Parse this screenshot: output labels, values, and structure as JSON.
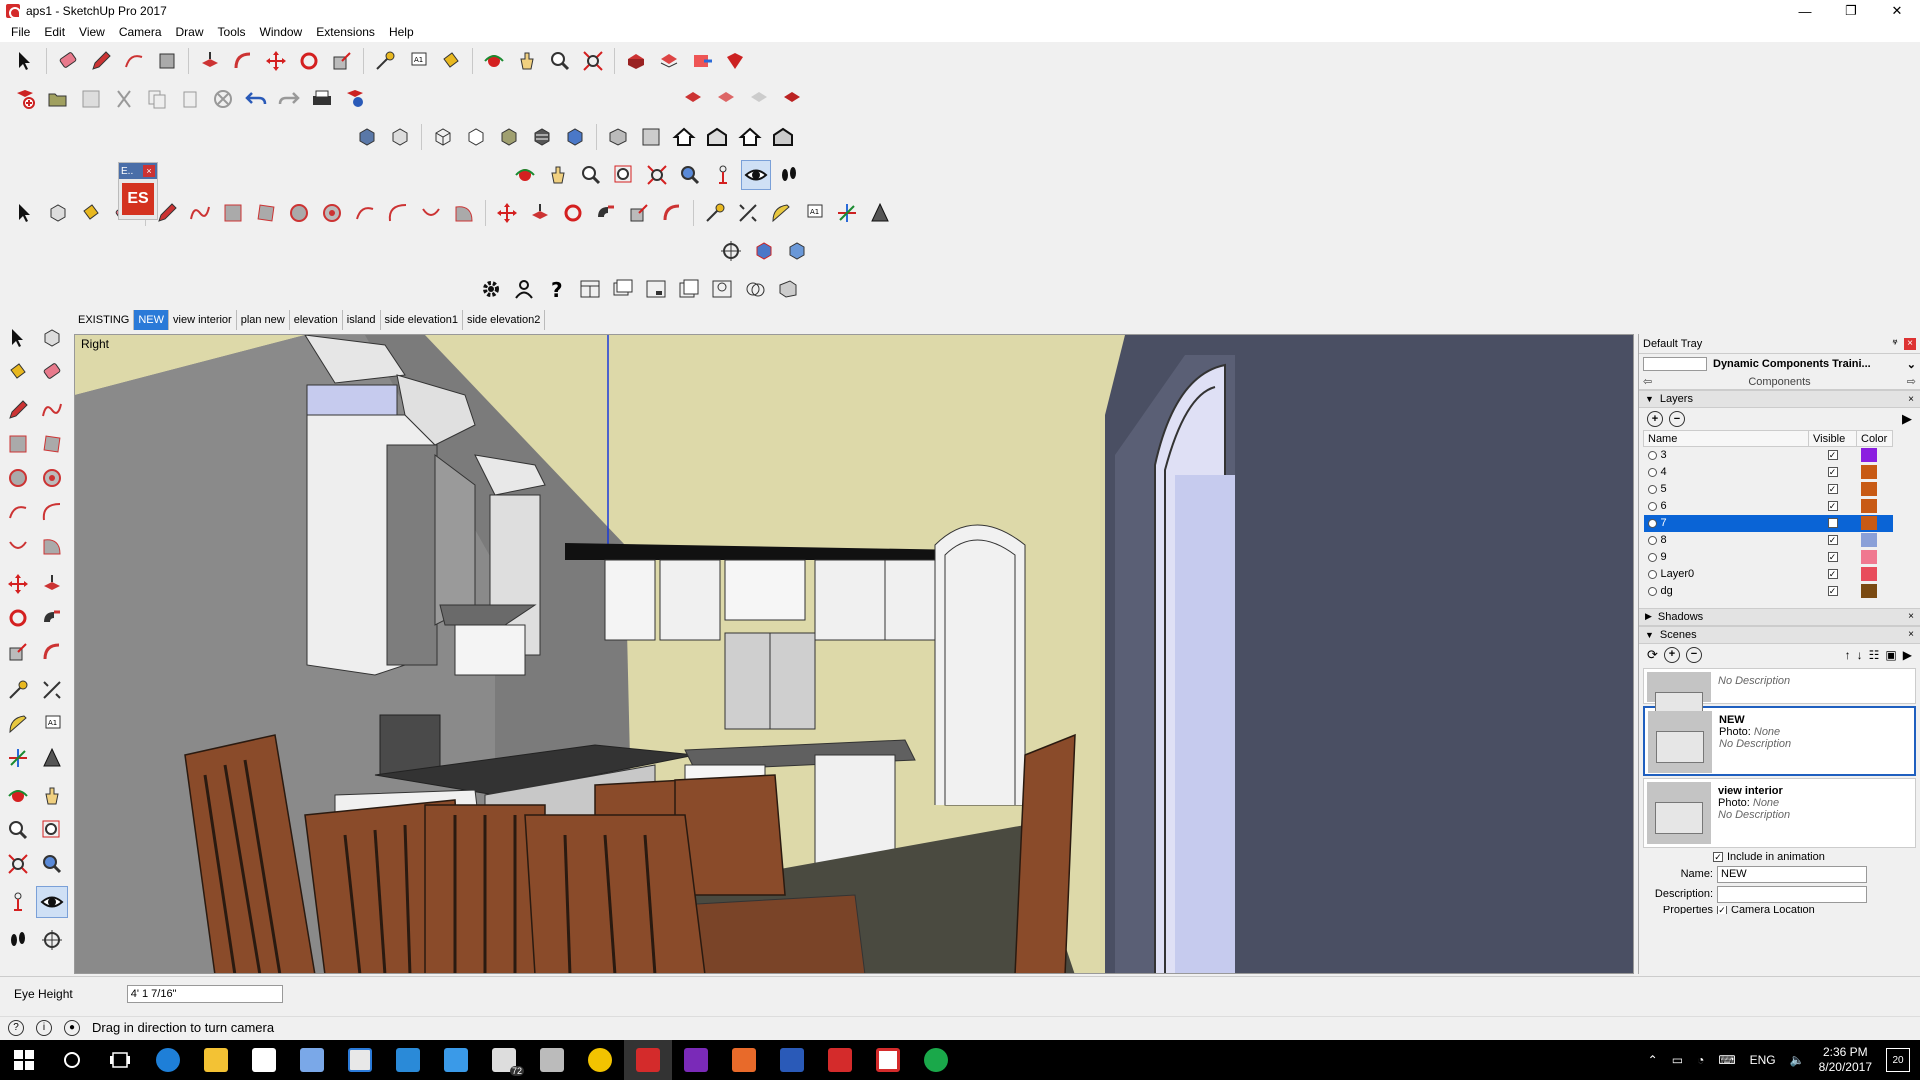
{
  "window": {
    "title": "aps1 - SketchUp Pro 2017",
    "minimize": "—",
    "maximize": "❐",
    "close": "✕"
  },
  "menu": [
    "File",
    "Edit",
    "View",
    "Camera",
    "Draw",
    "Tools",
    "Window",
    "Extensions",
    "Help"
  ],
  "es_widget": {
    "title": "E..",
    "close": "×",
    "logo": "ES"
  },
  "scene_tabs": [
    {
      "label": "EXISTING",
      "active": false
    },
    {
      "label": "NEW",
      "active": true
    },
    {
      "label": "view interior",
      "active": false
    },
    {
      "label": "plan new",
      "active": false
    },
    {
      "label": "elevation",
      "active": false
    },
    {
      "label": "island",
      "active": false
    },
    {
      "label": "side elevation1",
      "active": false
    },
    {
      "label": "side elevation2",
      "active": false
    }
  ],
  "viewport": {
    "view_label": "Right"
  },
  "tray": {
    "title": "Default Tray",
    "pin": "ⱍ",
    "close": "×",
    "components": {
      "name": "Dynamic Components Traini...",
      "section_label": "Components"
    },
    "layers": {
      "title": "Layers",
      "columns": {
        "name": "Name",
        "visible": "Visible",
        "color": "Color"
      },
      "rows": [
        {
          "name": "3",
          "color": "#8b1fe0",
          "selected": false
        },
        {
          "name": "4",
          "color": "#c85a14",
          "selected": false
        },
        {
          "name": "5",
          "color": "#c85a14",
          "selected": false
        },
        {
          "name": "6",
          "color": "#c85a14",
          "selected": false
        },
        {
          "name": "7",
          "color": "#c85a14",
          "selected": true
        },
        {
          "name": "8",
          "color": "#8aa0d8",
          "selected": false
        },
        {
          "name": "9",
          "color": "#f07890",
          "selected": false
        },
        {
          "name": "Layer0",
          "color": "#e84c5c",
          "selected": false
        },
        {
          "name": "dg",
          "color": "#7a4a12",
          "selected": false
        }
      ]
    },
    "shadows": {
      "title": "Shadows"
    },
    "scenes": {
      "title": "Scenes",
      "items": [
        {
          "name": "",
          "photo_label": "",
          "photo_value": "",
          "description": "No Description",
          "selected": false
        },
        {
          "name": "NEW",
          "photo_label": "Photo:",
          "photo_value": "None",
          "description": "No Description",
          "selected": true
        },
        {
          "name": "view interior",
          "photo_label": "Photo:",
          "photo_value": "None",
          "description": "No Description",
          "selected": false
        }
      ],
      "include_animation": "Include in animation",
      "name_label": "Name:",
      "name_value": "NEW",
      "description_label": "Description:",
      "description_value": "",
      "properties_label": "Properties",
      "camera_location_label": "Camera Location"
    }
  },
  "vcb": {
    "label": "Eye Height",
    "value": "4' 1 7/16\""
  },
  "status": {
    "message": "Drag in direction to turn camera"
  },
  "taskbar": {
    "time": "2:36 PM",
    "date": "8/20/2017",
    "language": "ENG",
    "notifications": "20",
    "mail_badge": "72"
  }
}
